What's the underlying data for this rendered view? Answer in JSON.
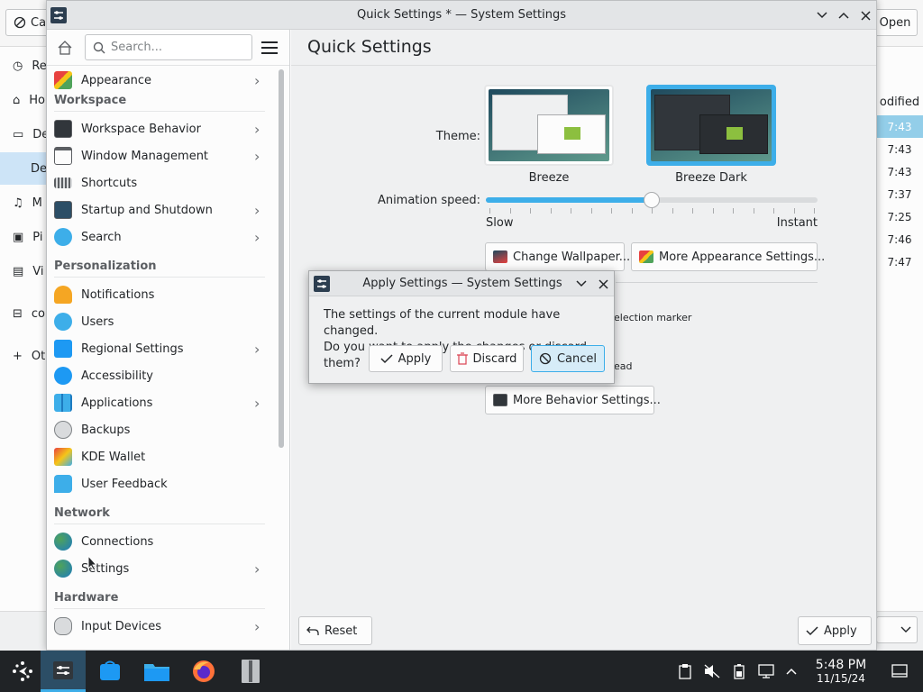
{
  "background_dialog": {
    "cancel_label": "Car",
    "open_label": "Open",
    "places": [
      "Re",
      "Ho",
      "De",
      "De",
      "M",
      "Pi",
      "Vi",
      "co",
      "Ot"
    ],
    "modified_header": "odified",
    "times": [
      "7:43",
      "7:43",
      "7:43",
      "7:37",
      "7:25",
      "7:46",
      "7:47"
    ]
  },
  "window": {
    "title": "Quick Settings * — System Settings"
  },
  "sidebar": {
    "search_placeholder": "Search...",
    "items": [
      {
        "label": "Appearance",
        "chevron": true
      },
      {
        "category": "Workspace"
      },
      {
        "label": "Workspace Behavior",
        "chevron": true
      },
      {
        "label": "Window Management",
        "chevron": true
      },
      {
        "label": "Shortcuts",
        "chevron": false
      },
      {
        "label": "Startup and Shutdown",
        "chevron": true
      },
      {
        "label": "Search",
        "chevron": true
      },
      {
        "category": "Personalization"
      },
      {
        "label": "Notifications",
        "chevron": false
      },
      {
        "label": "Users",
        "chevron": false
      },
      {
        "label": "Regional Settings",
        "chevron": true
      },
      {
        "label": "Accessibility",
        "chevron": false
      },
      {
        "label": "Applications",
        "chevron": true
      },
      {
        "label": "Backups",
        "chevron": false
      },
      {
        "label": "KDE Wallet",
        "chevron": false
      },
      {
        "label": "User Feedback",
        "chevron": false
      },
      {
        "category": "Network"
      },
      {
        "label": "Connections",
        "chevron": false
      },
      {
        "label": "Settings",
        "chevron": true
      },
      {
        "category": "Hardware"
      },
      {
        "label": "Input Devices",
        "chevron": true
      }
    ]
  },
  "content": {
    "page_title": "Quick Settings",
    "theme_label": "Theme:",
    "themes": [
      {
        "name": "Breeze",
        "selected": false
      },
      {
        "name": "Breeze Dark",
        "selected": true
      }
    ],
    "animation_label": "Animation speed:",
    "slider_min_label": "Slow",
    "slider_max_label": "Instant",
    "animation_value": 0.5,
    "change_wallpaper": "Change Wallpaper...",
    "more_appearance": "More Appearance Settings...",
    "partial_text_1": "election marker",
    "partial_text_2": "ead",
    "more_behavior": "More Behavior Settings...",
    "reset_label": "Reset",
    "apply_label": "Apply"
  },
  "dialog": {
    "title": "Apply Settings — System Settings",
    "message_line1": "The settings of the current module have changed.",
    "message_line2": "Do you want to apply the changes or discard them?",
    "apply_label": "Apply",
    "discard_label": "Discard",
    "cancel_label": "Cancel"
  },
  "taskbar": {
    "time": "5:48 PM",
    "date": "11/15/24"
  },
  "colors": {
    "accent": "#3daee9",
    "taskbar": "#202326",
    "dark_theme": "#31363b"
  }
}
